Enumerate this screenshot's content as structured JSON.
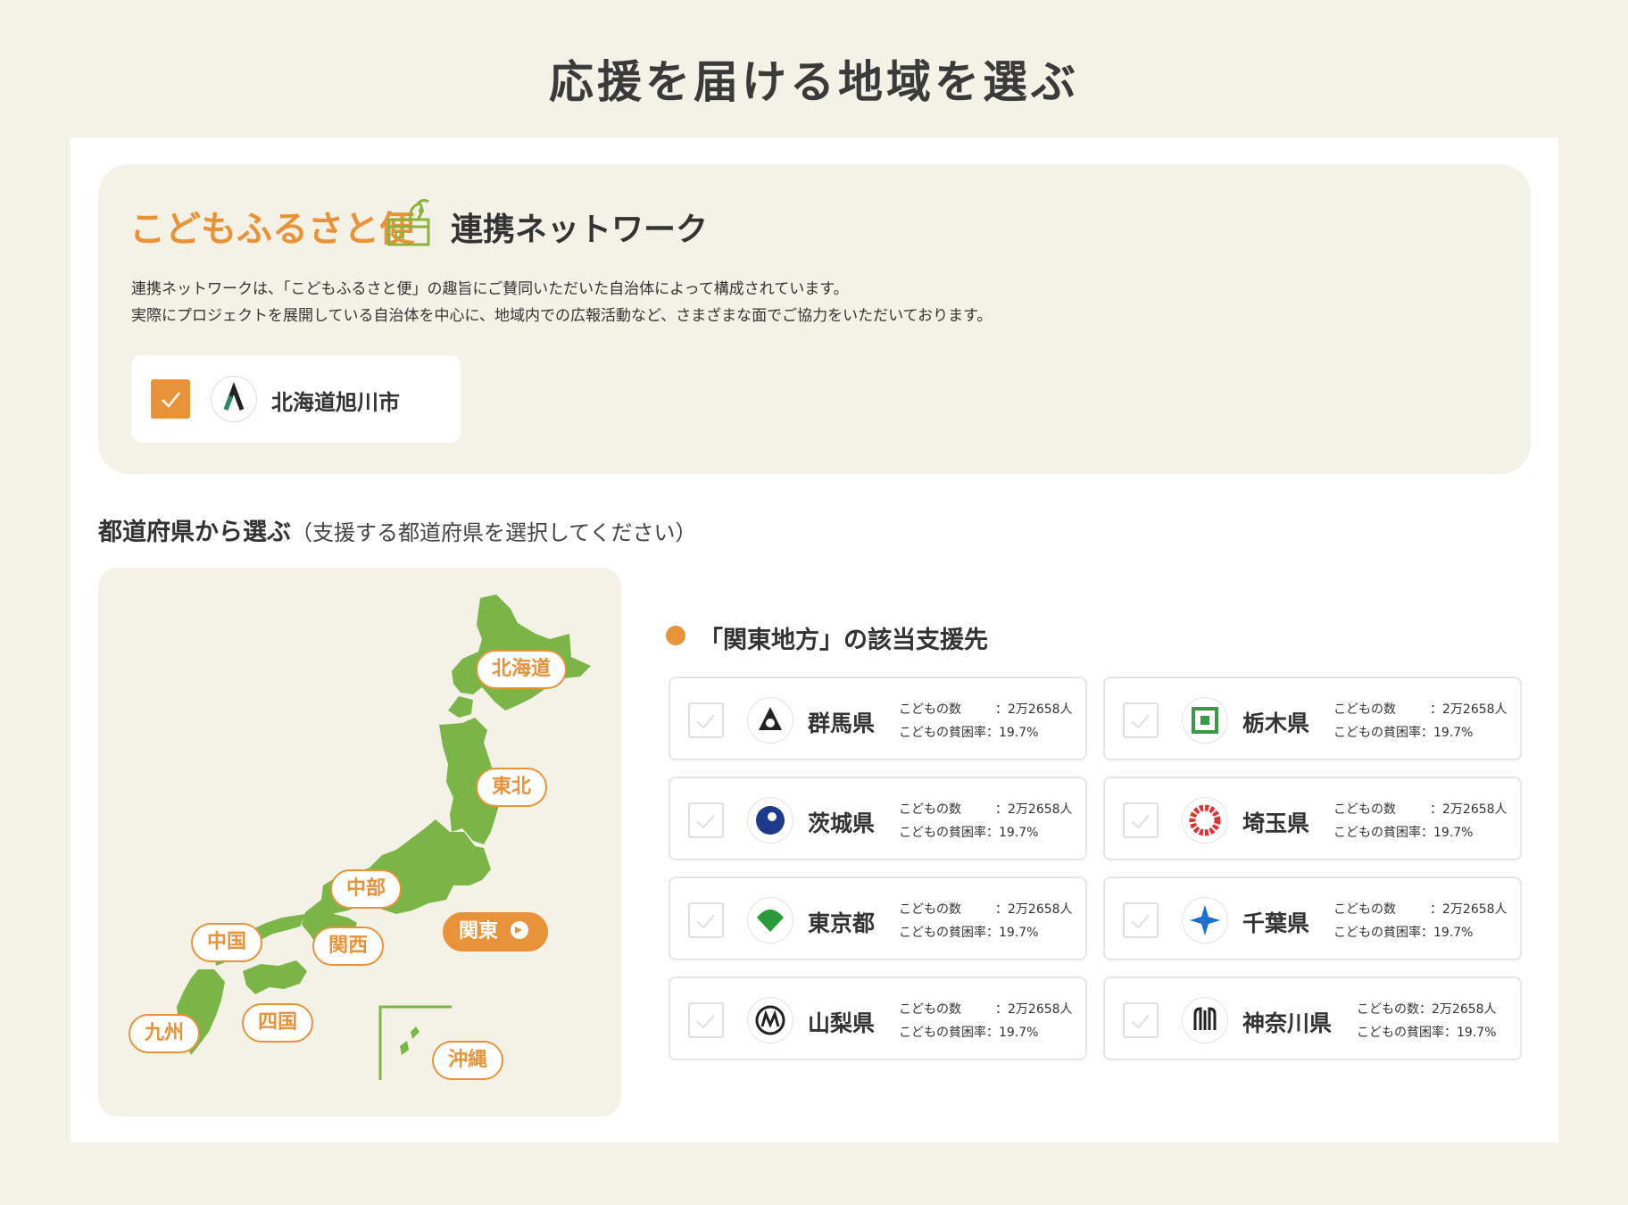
{
  "page": {
    "title": "応援を届ける地域を選ぶ"
  },
  "network": {
    "brand": "こどもふるさと便",
    "title": "連携ネットワーク",
    "description": [
      "連携ネットワークは、「こどもふるさと便」の趣旨にご賛同いただいた自治体によって構成されています。",
      "実際にプロジェクトを展開している自治体を中心に、地域内での広報活動など、さまざまな面でご協力をいただいております。"
    ],
    "city": {
      "name": "北海道旭川市",
      "checked": true
    }
  },
  "prefecture_section": {
    "heading": "都道府県から選ぶ",
    "subheading": "（支援する都道府県を選択してください）"
  },
  "map": {
    "regions": [
      {
        "label": "北海道",
        "active": false
      },
      {
        "label": "東北",
        "active": false
      },
      {
        "label": "中部",
        "active": false
      },
      {
        "label": "関東",
        "active": true
      },
      {
        "label": "中国",
        "active": false
      },
      {
        "label": "関西",
        "active": false
      },
      {
        "label": "九州",
        "active": false
      },
      {
        "label": "四国",
        "active": false
      },
      {
        "label": "沖縄",
        "active": false
      }
    ]
  },
  "results": {
    "title": "「関東地方」の該当支援先",
    "prefectures": [
      {
        "name": "群馬県",
        "children_label": "こどもの数",
        "children_sep": "：",
        "children_value": "2万2658人",
        "poverty_label": "こどもの貧困率",
        "poverty_sep": "：",
        "poverty_value": "19.7%",
        "emblem": "gunma-emblem-icon"
      },
      {
        "name": "栃木県",
        "children_label": "こどもの数",
        "children_sep": "：",
        "children_value": "2万2658人",
        "poverty_label": "こどもの貧困率",
        "poverty_sep": "：",
        "poverty_value": "19.7%",
        "emblem": "tochigi-emblem-icon"
      },
      {
        "name": "茨城県",
        "children_label": "こどもの数",
        "children_sep": "：",
        "children_value": "2万2658人",
        "poverty_label": "こどもの貧困率",
        "poverty_sep": "：",
        "poverty_value": "19.7%",
        "emblem": "ibaraki-emblem-icon"
      },
      {
        "name": "埼玉県",
        "children_label": "こどもの数",
        "children_sep": "：",
        "children_value": "2万2658人",
        "poverty_label": "こどもの貧困率",
        "poverty_sep": "：",
        "poverty_value": "19.7%",
        "emblem": "saitama-emblem-icon"
      },
      {
        "name": "東京都",
        "children_label": "こどもの数",
        "children_sep": "：",
        "children_value": "2万2658人",
        "poverty_label": "こどもの貧困率",
        "poverty_sep": "：",
        "poverty_value": "19.7%",
        "emblem": "tokyo-emblem-icon"
      },
      {
        "name": "千葉県",
        "children_label": "こどもの数",
        "children_sep": "：",
        "children_value": "2万2658人",
        "poverty_label": "こどもの貧困率",
        "poverty_sep": "：",
        "poverty_value": "19.7%",
        "emblem": "chiba-emblem-icon"
      },
      {
        "name": "山梨県",
        "children_label": "こどもの数",
        "children_sep": "：",
        "children_value": "2万2658人",
        "poverty_label": "こどもの貧困率",
        "poverty_sep": "：",
        "poverty_value": "19.7%",
        "emblem": "yamanashi-emblem-icon"
      },
      {
        "name": "神奈川県",
        "children_label": "こどもの数",
        "children_sep": "：",
        "children_value": "2万2658人",
        "poverty_label": "こどもの貧困率",
        "poverty_sep": "：",
        "poverty_value": "19.7%",
        "emblem": "kanagawa-emblem-icon"
      }
    ]
  },
  "colors": {
    "background": "#f4f2e7",
    "accent": "#e8923a",
    "map_green": "#7bb548"
  }
}
